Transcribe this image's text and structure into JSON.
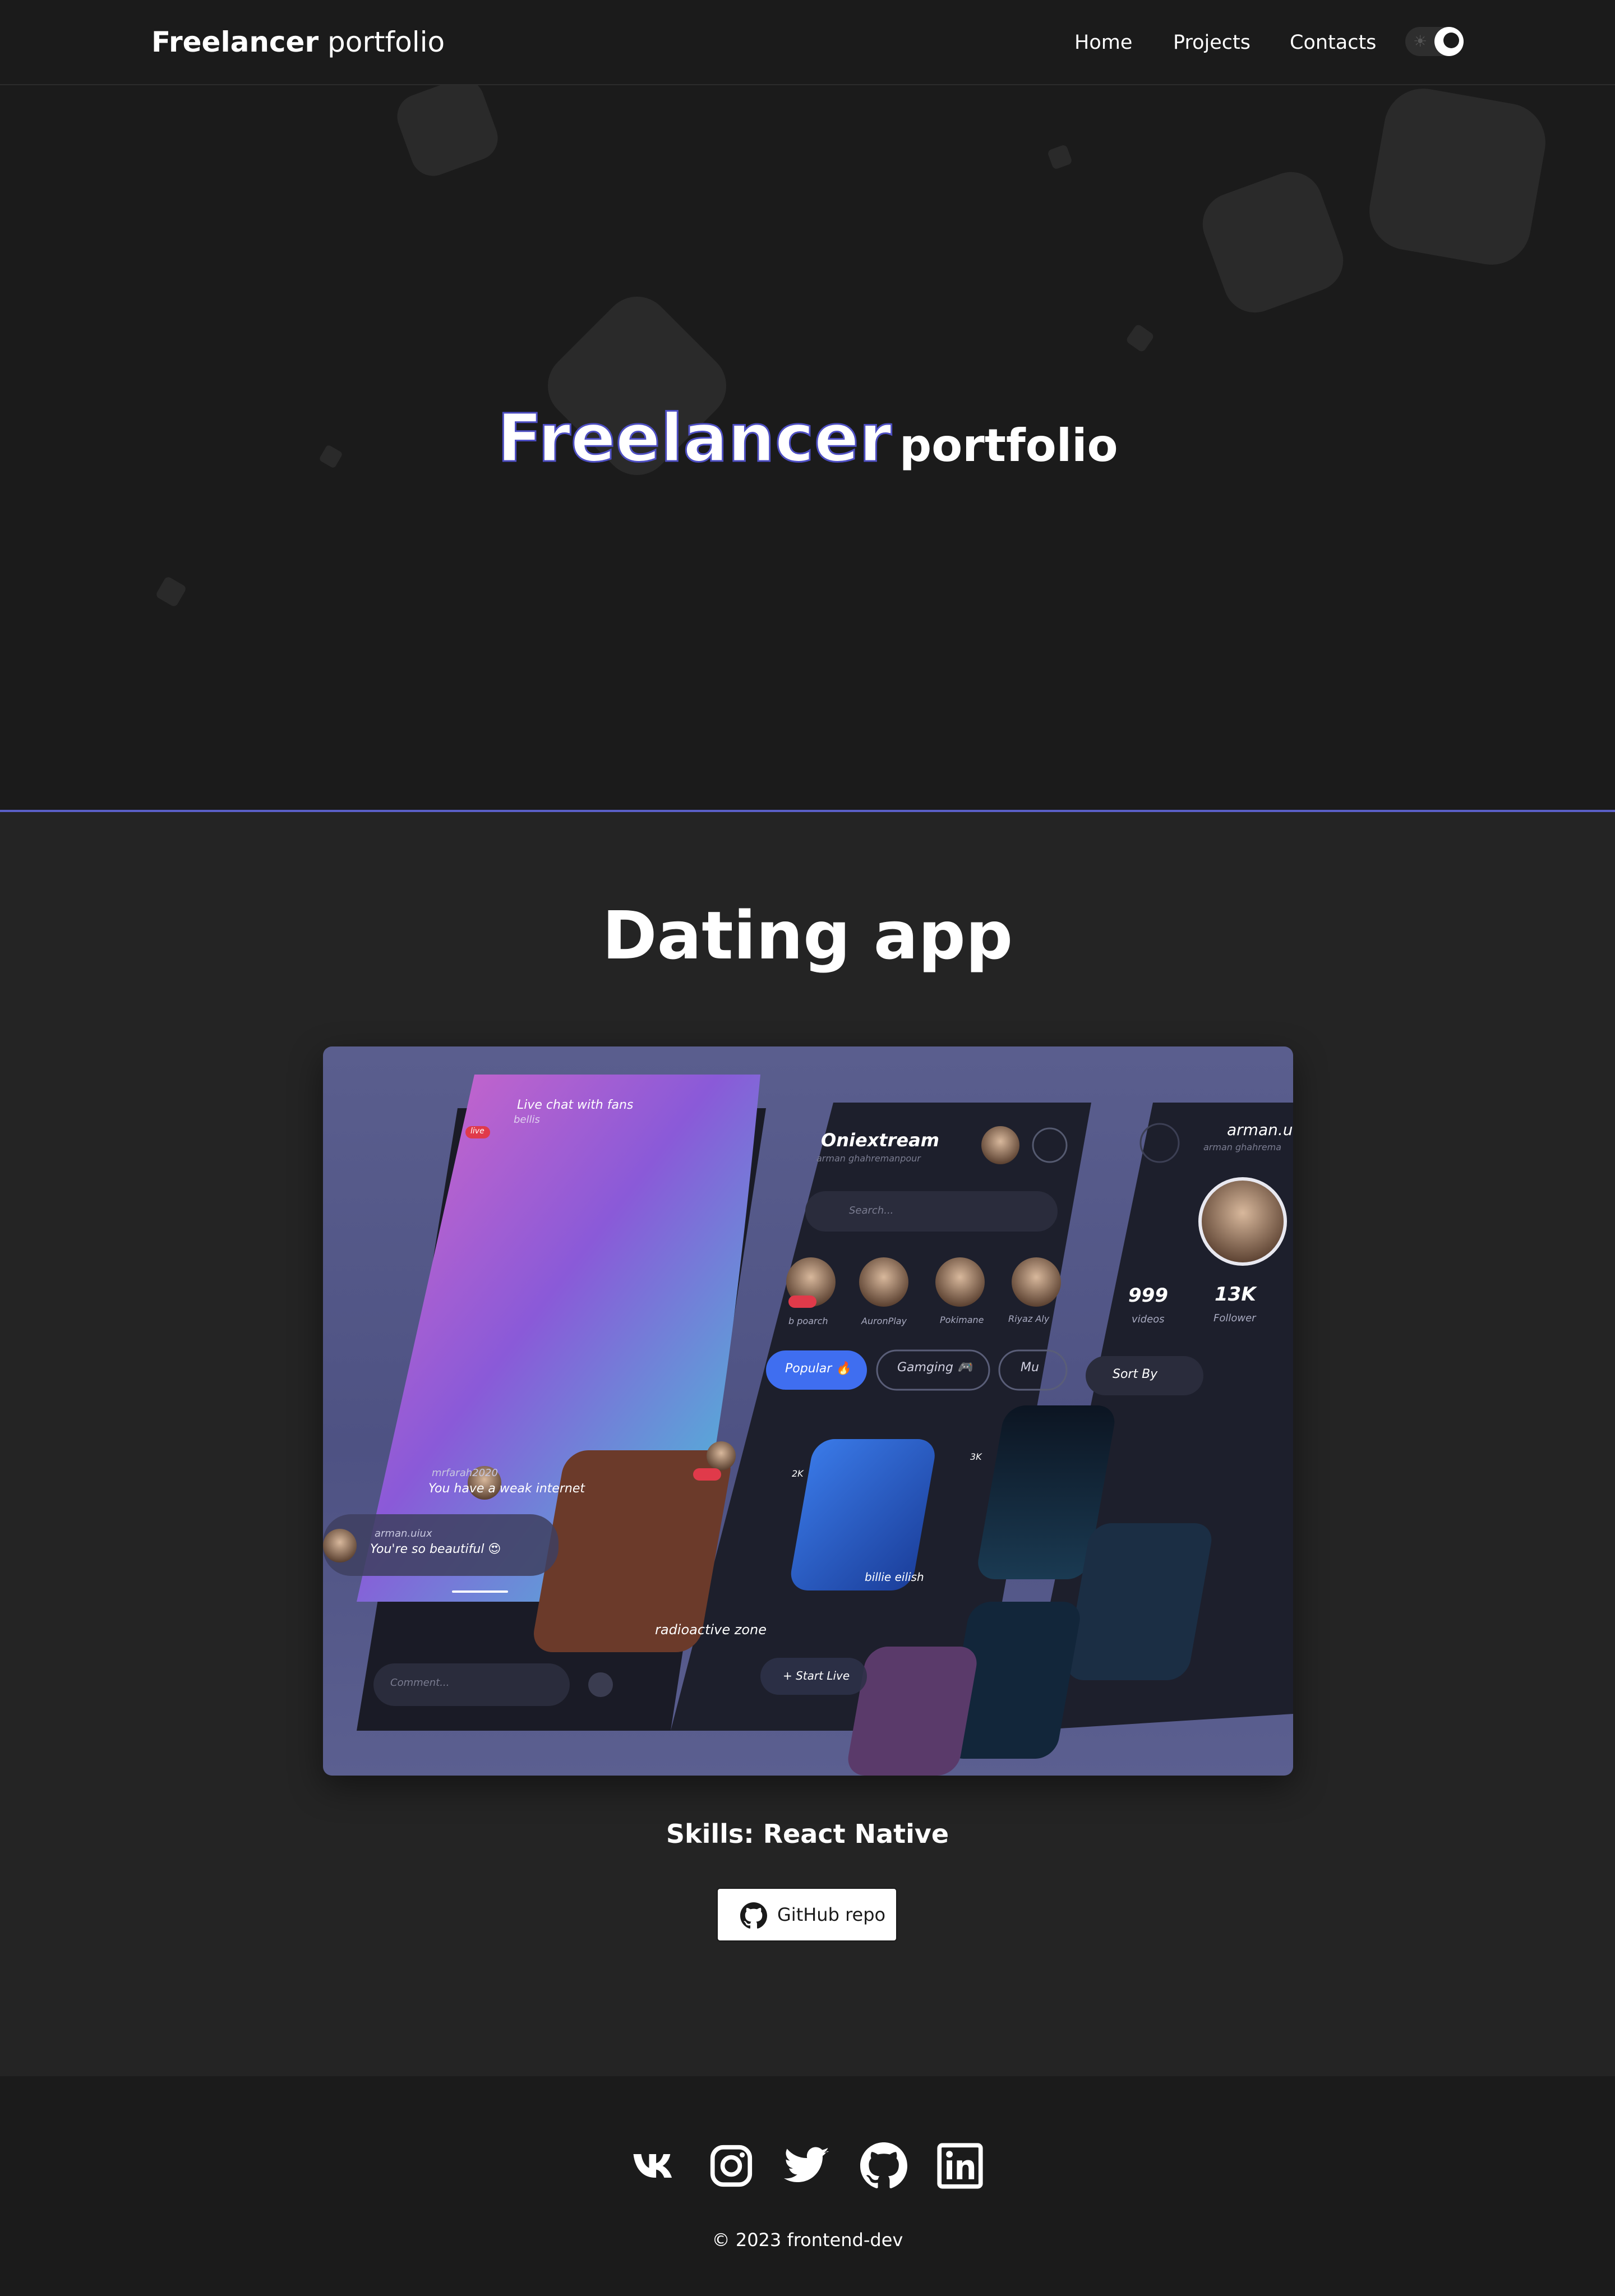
{
  "header": {
    "brand_bold": "Freelancer",
    "brand_light": "portfolio",
    "nav": [
      {
        "label": "Home"
      },
      {
        "label": "Projects"
      },
      {
        "label": "Contacts"
      }
    ]
  },
  "hero": {
    "title_outline": "Freelancer",
    "title_solid": "portfolio"
  },
  "project": {
    "title": "Dating app",
    "skills": "Skills: React Native",
    "repo_button": "GitHub repo",
    "mockup": {
      "chat_header": "Live chat with fans",
      "chat_sub": "bellis",
      "live_badge": "live",
      "msg1_user": "mrfarah2020",
      "msg1_text": "You have a weak internet",
      "msg2_user": "arman.uiux",
      "msg2_text": "You're so beautiful 😍",
      "comment_placeholder": "Comment...",
      "app_name": "Oniextream",
      "app_user": "arman ghahremanpour",
      "search_placeholder": "Search...",
      "stories": [
        "b poarch",
        "AuronPlay",
        "Pokimane",
        "Riyaz Aly"
      ],
      "chip_popular": "Popular 🔥",
      "chip_gaming": "Gamging 🎮",
      "chip_more": "Mu",
      "card1_title": "radioactive zone",
      "card2_title": "billie eilish",
      "views_2k": "2K",
      "views_3k": "3K",
      "start_live": "+ Start Live",
      "profile_name": "arman.ui",
      "profile_sub": "arman ghahrema",
      "stat_videos_num": "999",
      "stat_videos_label": "videos",
      "stat_followers_num": "13K",
      "stat_followers_label": "Follower",
      "sort_by": "Sort By"
    }
  },
  "footer": {
    "copyright": "© 2023 frontend-dev",
    "social_icons": [
      "vk-icon",
      "instagram-icon",
      "twitter-icon",
      "github-icon",
      "linkedin-icon"
    ]
  },
  "colors": {
    "accent": "#5a5fc7",
    "background": "#1b1b1b",
    "section": "#242424"
  }
}
